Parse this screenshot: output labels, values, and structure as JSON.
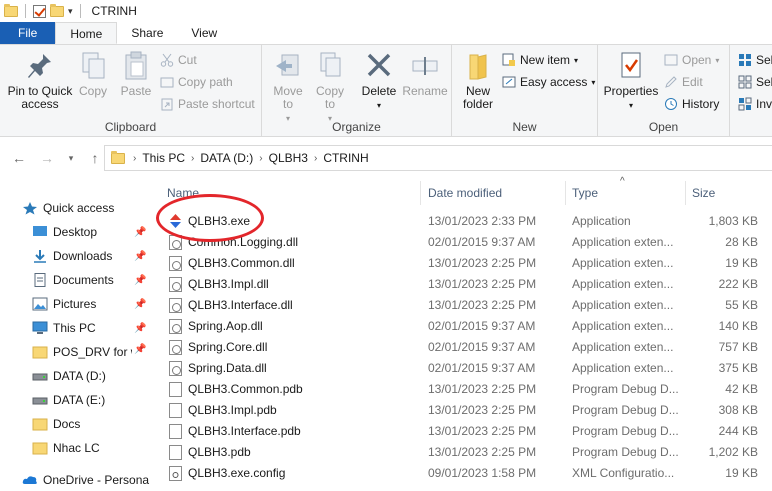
{
  "window": {
    "title": "CTRINH"
  },
  "tabs": [
    {
      "label": "File"
    },
    {
      "label": "Home"
    },
    {
      "label": "Share"
    },
    {
      "label": "View"
    }
  ],
  "ribbon": {
    "clipboard": {
      "label": "Clipboard",
      "pin": "Pin to Quick access",
      "copy": "Copy",
      "paste": "Paste",
      "cut": "Cut",
      "copy_path": "Copy path",
      "paste_shortcut": "Paste shortcut"
    },
    "organize": {
      "label": "Organize",
      "move_to": "Move to",
      "copy_to": "Copy to",
      "delete": "Delete",
      "rename": "Rename"
    },
    "new": {
      "label": "New",
      "new_folder": "New folder",
      "new_item": "New item",
      "easy_access": "Easy access"
    },
    "open": {
      "label": "Open",
      "properties": "Properties",
      "open": "Open",
      "edit": "Edit",
      "history": "History"
    },
    "select": {
      "item1": "Sel",
      "item2": "Sel",
      "item3": "Inv"
    }
  },
  "address": {
    "crumbs": [
      "This PC",
      "DATA (D:)",
      "QLBH3",
      "CTRINH"
    ]
  },
  "nav_pane": {
    "items": [
      {
        "label": "Quick access",
        "icon": "star-icon"
      },
      {
        "label": "Desktop",
        "icon": "desktop-icon",
        "pinned": true
      },
      {
        "label": "Downloads",
        "icon": "download-icon",
        "pinned": true
      },
      {
        "label": "Documents",
        "icon": "documents-icon",
        "pinned": true
      },
      {
        "label": "Pictures",
        "icon": "pictures-icon",
        "pinned": true
      },
      {
        "label": "This PC",
        "icon": "pc-icon",
        "pinned": true
      },
      {
        "label": "POS_DRV for w",
        "icon": "folder-icon",
        "pinned": true
      },
      {
        "label": "DATA (D:)",
        "icon": "drive-icon"
      },
      {
        "label": "DATA (E:)",
        "icon": "drive-icon"
      },
      {
        "label": "Docs",
        "icon": "folder-icon"
      },
      {
        "label": "Nhac LC",
        "icon": "folder-icon"
      },
      {
        "label": "OneDrive - Persona",
        "icon": "cloud-icon"
      }
    ]
  },
  "columns": {
    "name": "Name",
    "date": "Date modified",
    "type": "Type",
    "size": "Size"
  },
  "files": [
    {
      "name": "QLBH3.exe",
      "date": "13/01/2023 2:33 PM",
      "type": "Application",
      "size": "1,803 KB",
      "icon": "exe-icon"
    },
    {
      "name": "Common.Logging.dll",
      "date": "02/01/2015 9:37 AM",
      "type": "Application exten...",
      "size": "28 KB",
      "icon": "dll-icon"
    },
    {
      "name": "QLBH3.Common.dll",
      "date": "13/01/2023 2:25 PM",
      "type": "Application exten...",
      "size": "19 KB",
      "icon": "dll-icon"
    },
    {
      "name": "QLBH3.Impl.dll",
      "date": "13/01/2023 2:25 PM",
      "type": "Application exten...",
      "size": "222 KB",
      "icon": "dll-icon"
    },
    {
      "name": "QLBH3.Interface.dll",
      "date": "13/01/2023 2:25 PM",
      "type": "Application exten...",
      "size": "55 KB",
      "icon": "dll-icon"
    },
    {
      "name": "Spring.Aop.dll",
      "date": "02/01/2015 9:37 AM",
      "type": "Application exten...",
      "size": "140 KB",
      "icon": "dll-icon"
    },
    {
      "name": "Spring.Core.dll",
      "date": "02/01/2015 9:37 AM",
      "type": "Application exten...",
      "size": "757 KB",
      "icon": "dll-icon"
    },
    {
      "name": "Spring.Data.dll",
      "date": "02/01/2015 9:37 AM",
      "type": "Application exten...",
      "size": "375 KB",
      "icon": "dll-icon"
    },
    {
      "name": "QLBH3.Common.pdb",
      "date": "13/01/2023 2:25 PM",
      "type": "Program Debug D...",
      "size": "42 KB",
      "icon": "pdb-icon"
    },
    {
      "name": "QLBH3.Impl.pdb",
      "date": "13/01/2023 2:25 PM",
      "type": "Program Debug D...",
      "size": "308 KB",
      "icon": "pdb-icon"
    },
    {
      "name": "QLBH3.Interface.pdb",
      "date": "13/01/2023 2:25 PM",
      "type": "Program Debug D...",
      "size": "244 KB",
      "icon": "pdb-icon"
    },
    {
      "name": "QLBH3.pdb",
      "date": "13/01/2023 2:25 PM",
      "type": "Program Debug D...",
      "size": "1,202 KB",
      "icon": "pdb-icon"
    },
    {
      "name": "QLBH3.exe.config",
      "date": "09/01/2023 1:58 PM",
      "type": "XML Configuratio...",
      "size": "19 KB",
      "icon": "config-icon"
    }
  ],
  "colors": {
    "file_tab": "#1a5fb4",
    "highlight_ellipse": "#e3262b",
    "header_text": "#4c607a"
  }
}
